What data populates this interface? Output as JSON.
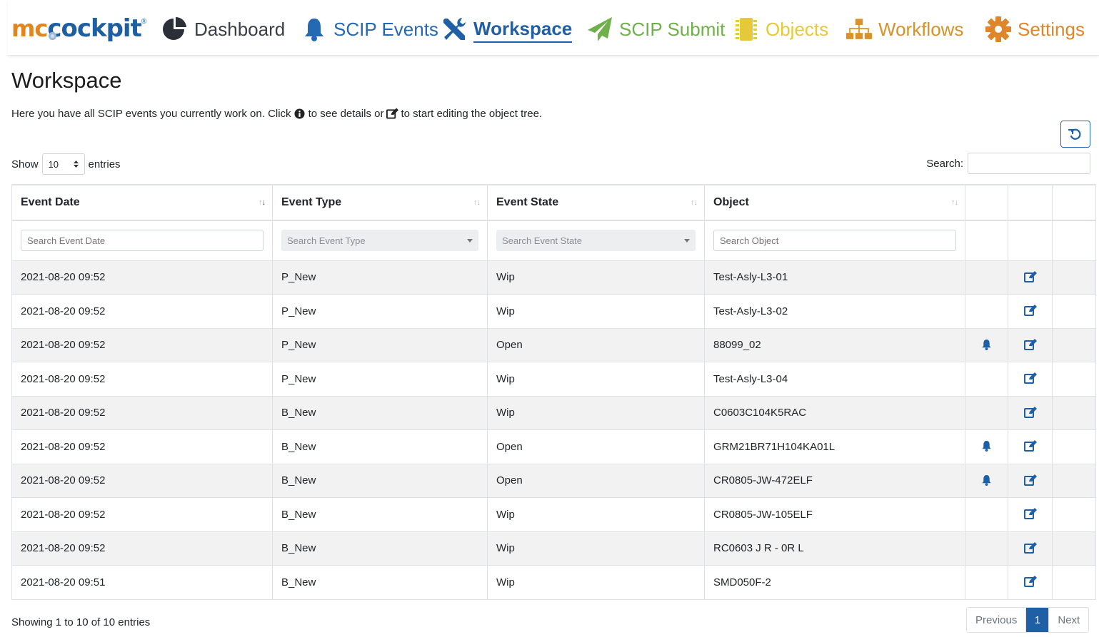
{
  "nav": {
    "brand_mc": "mc",
    "brand_cockpit": "cockpit",
    "brand_reg": "®",
    "items": [
      {
        "label": "Dashboard",
        "icon": "pie-chart-icon"
      },
      {
        "label": "SCIP Events",
        "icon": "bell-icon"
      },
      {
        "label": "Workspace",
        "icon": "tools-icon",
        "active": true
      },
      {
        "label": "SCIP Submit",
        "icon": "paper-plane-icon"
      },
      {
        "label": "Objects",
        "icon": "microchip-icon"
      },
      {
        "label": "Workflows",
        "icon": "sitemap-icon"
      },
      {
        "label": "Settings",
        "icon": "gear-icon"
      }
    ]
  },
  "page": {
    "title": "Workspace",
    "desc_part1": "Here you have all SCIP events you currently work on. Click",
    "desc_part2": "to see details or",
    "desc_part3": "to start editing the object tree."
  },
  "controls": {
    "show_label": "Show",
    "page_length": "10",
    "entries_label": "entries",
    "search_label": "Search:"
  },
  "table": {
    "columns": [
      "Event Date",
      "Event Type",
      "Event State",
      "Object"
    ],
    "filters": {
      "event_date": "Search Event Date",
      "event_type": "Search Event Type",
      "event_state": "Search Event State",
      "object": "Search Object"
    },
    "rows": [
      {
        "date": "2021-08-20 09:52",
        "type": "P_New",
        "state": "Wip",
        "object": "Test-Asly-L3-01",
        "bell": false
      },
      {
        "date": "2021-08-20 09:52",
        "type": "P_New",
        "state": "Wip",
        "object": "Test-Asly-L3-02",
        "bell": false
      },
      {
        "date": "2021-08-20 09:52",
        "type": "P_New",
        "state": "Open",
        "object": "88099_02",
        "bell": true
      },
      {
        "date": "2021-08-20 09:52",
        "type": "P_New",
        "state": "Wip",
        "object": "Test-Asly-L3-04",
        "bell": false
      },
      {
        "date": "2021-08-20 09:52",
        "type": "B_New",
        "state": "Wip",
        "object": "C0603C104K5RAC",
        "bell": false
      },
      {
        "date": "2021-08-20 09:52",
        "type": "B_New",
        "state": "Open",
        "object": "GRM21BR71H104KA01L",
        "bell": true
      },
      {
        "date": "2021-08-20 09:52",
        "type": "B_New",
        "state": "Open",
        "object": "CR0805-JW-472ELF",
        "bell": true
      },
      {
        "date": "2021-08-20 09:52",
        "type": "B_New",
        "state": "Wip",
        "object": "CR0805-JW-105ELF",
        "bell": false
      },
      {
        "date": "2021-08-20 09:52",
        "type": "B_New",
        "state": "Wip",
        "object": "RC0603 J R - 0R L",
        "bell": false
      },
      {
        "date": "2021-08-20 09:51",
        "type": "B_New",
        "state": "Wip",
        "object": "SMD050F-2",
        "bell": false
      }
    ]
  },
  "footer": {
    "info": "Showing 1 to 10 of 10 entries",
    "previous": "Previous",
    "current_page": "1",
    "next": "Next"
  },
  "colors": {
    "primary": "#1e5fa6",
    "brand_orange": "#e2861b",
    "submit_green": "#6fb04b",
    "objects_yellow": "#e6c93a",
    "workflows_orange": "#d99128",
    "settings_orange": "#e0862a"
  }
}
